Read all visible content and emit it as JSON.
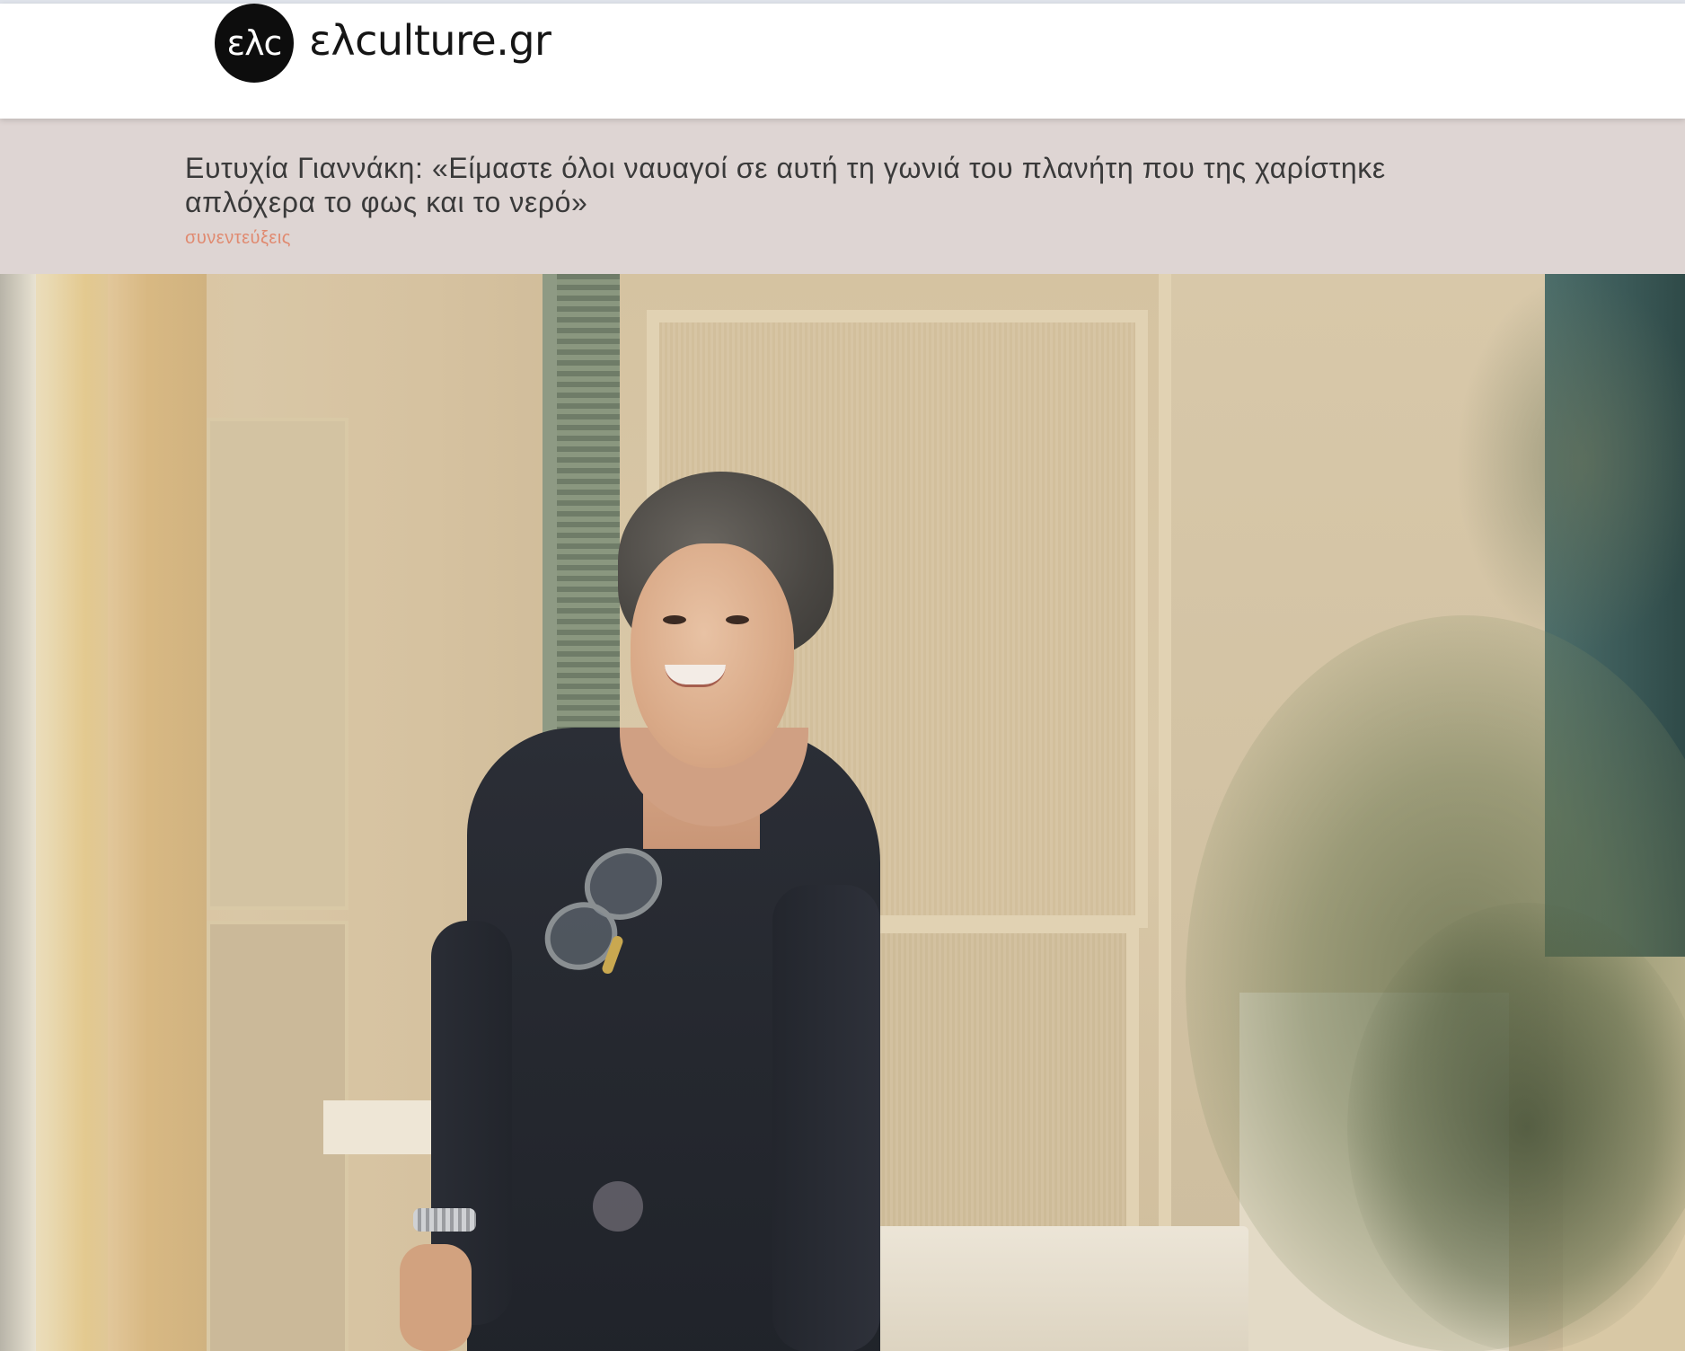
{
  "header": {
    "logo_text": "ελc",
    "site_name": "ελculture.gr"
  },
  "article": {
    "title": "Ευτυχία Γιαννάκη: «Είμαστε όλοι ναυαγοί σε αυτή τη γωνιά του πλανήτη που της χαρίστηκε απλόχερα το φως και το νερό»",
    "category": "συνεντεύξεις"
  },
  "colors": {
    "header_bg": "#ffffff",
    "title_band_bg": "#ded5d3",
    "title_text": "#3a3a3a",
    "category_text": "#e08a70",
    "logo_bg": "#0d0d0d"
  }
}
